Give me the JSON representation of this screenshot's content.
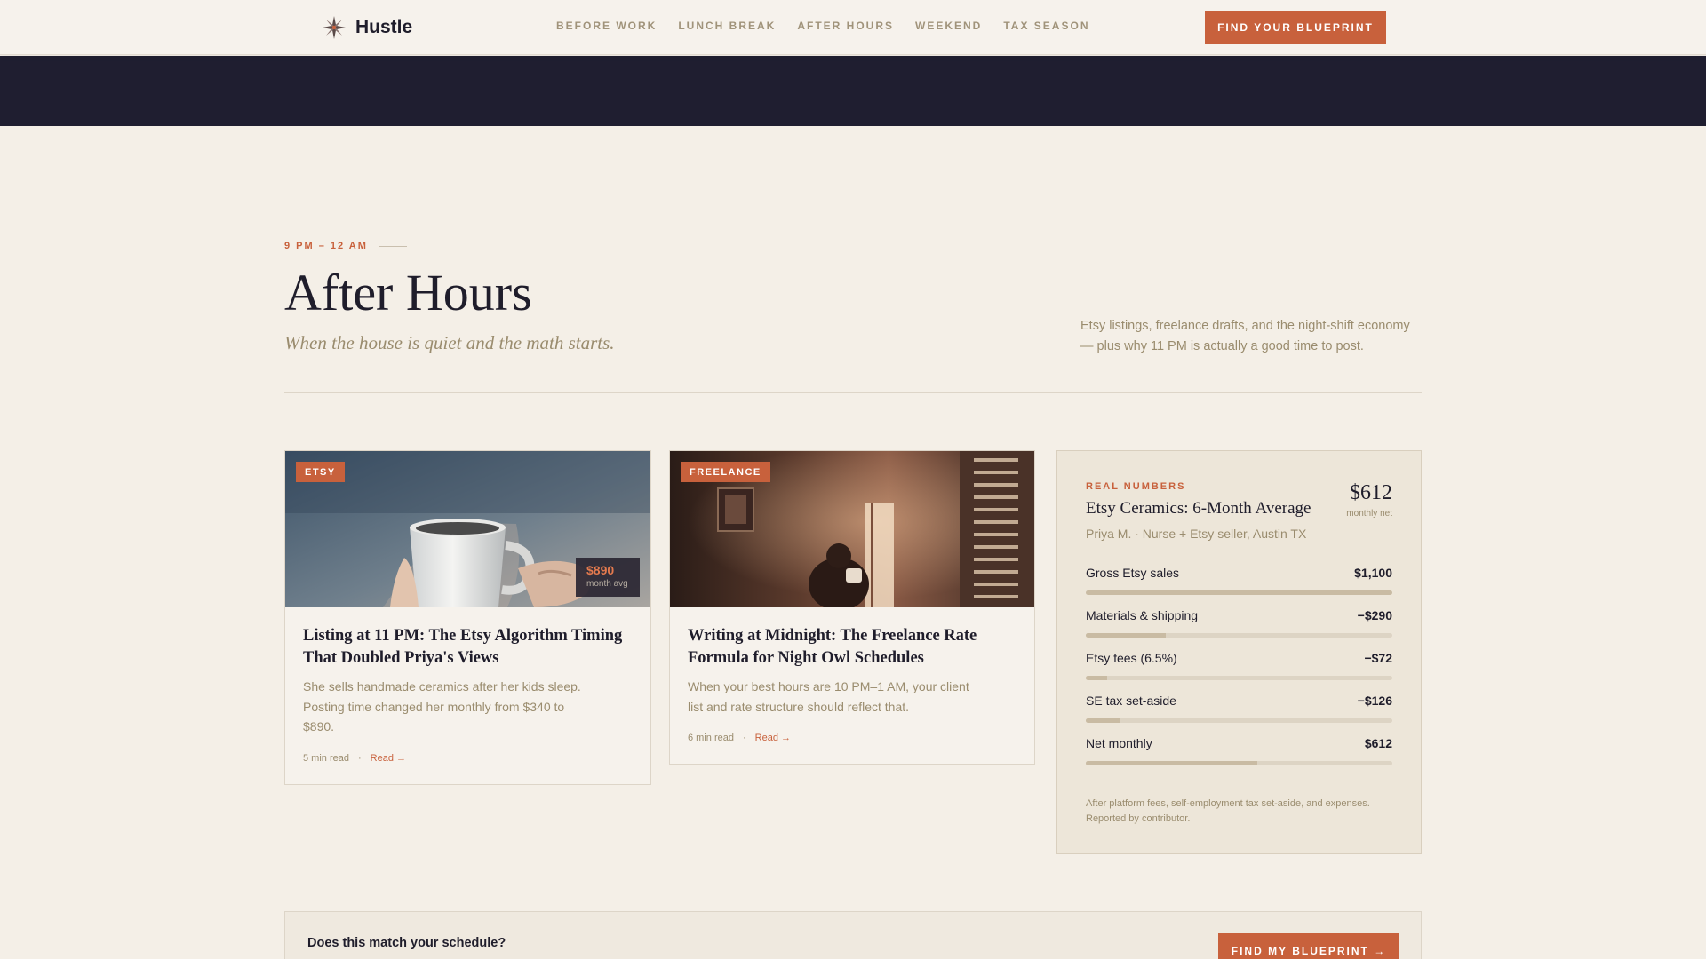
{
  "nav": {
    "logo_text": "Hustle",
    "links": [
      "BEFORE WORK",
      "LUNCH BREAK",
      "AFTER HOURS",
      "WEEKEND",
      "TAX SEASON"
    ],
    "cta_label": "FIND YOUR BLUEPRINT"
  },
  "section": {
    "eyebrow": "9 PM – 12 AM",
    "title": "After Hours",
    "subtitle": "When the house is quiet and the math starts.",
    "description": "Etsy listings, freelance drafts, and the night-shift economy — plus why 11 PM is actually a good time to post."
  },
  "cards": [
    {
      "tag": "ETSY",
      "stat_value": "$890",
      "stat_label": "month avg",
      "title": "Listing at 11 PM: The Etsy Algorithm Timing That Doubled Priya's Views",
      "excerpt": "She sells handmade ceramics after her kids sleep. Posting time changed her monthly from $340 to $890.",
      "read_time": "5 min read",
      "dot": "·",
      "read_label": "Read →"
    },
    {
      "tag": "FREELANCE",
      "title": "Writing at Midnight: The Freelance Rate Formula for Night Owl Schedules",
      "excerpt": "When your best hours are 10 PM–1 AM, your client list and rate structure should reflect that.",
      "read_time": "6 min read",
      "dot": "·",
      "read_label": "Read →"
    }
  ],
  "real_numbers": {
    "eyebrow": "REAL NUMBERS",
    "title": "Etsy Ceramics: 6-Month Average",
    "who": "Priya M. · Nurse + Etsy seller, Austin TX",
    "total_value": "$612",
    "total_label": "monthly net",
    "rows": [
      {
        "label": "Gross Etsy sales",
        "value": "$1,100",
        "fill": 1.0
      },
      {
        "label": "Materials & shipping",
        "value": "−$290",
        "fill": 0.26
      },
      {
        "label": "Etsy fees (6.5%)",
        "value": "−$72",
        "fill": 0.07
      },
      {
        "label": "SE tax set-aside",
        "value": "−$126",
        "fill": 0.11
      },
      {
        "label": "Net monthly",
        "value": "$612",
        "fill": 0.56
      }
    ],
    "note": "After platform fees, self-employment tax set-aside, and expenses. Reported by contributor."
  },
  "cta": {
    "question": "Does this match your schedule?",
    "button_label": "FIND MY BLUEPRINT →"
  },
  "colors": {
    "accent": "#c8613c",
    "navy": "#1f1e30",
    "background": "#f4efe7",
    "muted": "#9a8c6e"
  },
  "icons": [
    "compass-star-icon"
  ]
}
